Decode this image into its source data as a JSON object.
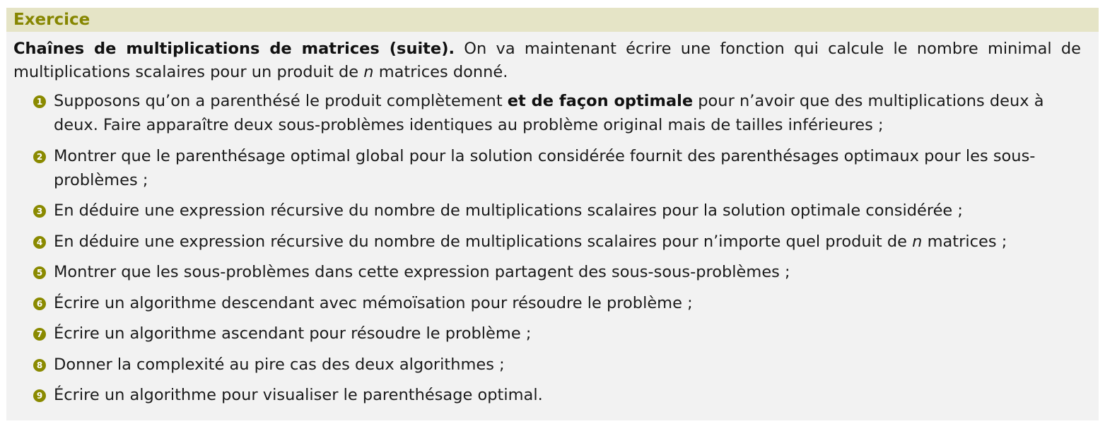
{
  "block": {
    "title": "Exercice",
    "intro": {
      "heading": "Chaînes de multiplications de matrices (suite).",
      "text_before_n": " On va maintenant écrire une fonction qui calcule le nombre minimal de multiplications scalaires pour un produit de ",
      "n": "n",
      "text_after_n": " matrices donné."
    },
    "items": [
      {
        "number": "1",
        "before_bold": "Supposons qu’on a parenthésé le produit complètement ",
        "bold": "et de façon optimale",
        "after_bold": " pour n’avoir que des multiplications deux à deux. Faire apparaître deux sous-problèmes identiques au problème original mais de tailles inférieures ;"
      },
      {
        "number": "2",
        "text": "Montrer que le parenthésage optimal global pour la solution considérée fournit des parenthésages optimaux pour les sous-problèmes ;"
      },
      {
        "number": "3",
        "text": "En déduire une expression récursive du nombre de multiplications scalaires pour la solution optimale considérée ;"
      },
      {
        "number": "4",
        "before_n": "En déduire une expression récursive du nombre de multiplications scalaires pour n’importe quel produit de ",
        "n": "n",
        "after_n": " matrices ;"
      },
      {
        "number": "5",
        "text": "Montrer que les sous-problèmes dans cette expression partagent des sous-sous-problèmes ;"
      },
      {
        "number": "6",
        "text": "Écrire un algorithme descendant avec mémoïsation pour résoudre le problème ;"
      },
      {
        "number": "7",
        "text": "Écrire un algorithme ascendant pour résoudre le problème ;"
      },
      {
        "number": "8",
        "text": "Donner la complexité au pire cas des deux algorithmes ;"
      },
      {
        "number": "9",
        "text": "Écrire un algorithme pour visualiser le parenthésage optimal."
      }
    ],
    "colors": {
      "title_bar": "#e5e4c6",
      "title_text": "#868600",
      "body_background": "#f2f2f2",
      "number_bullet": "#8a8a00"
    }
  }
}
